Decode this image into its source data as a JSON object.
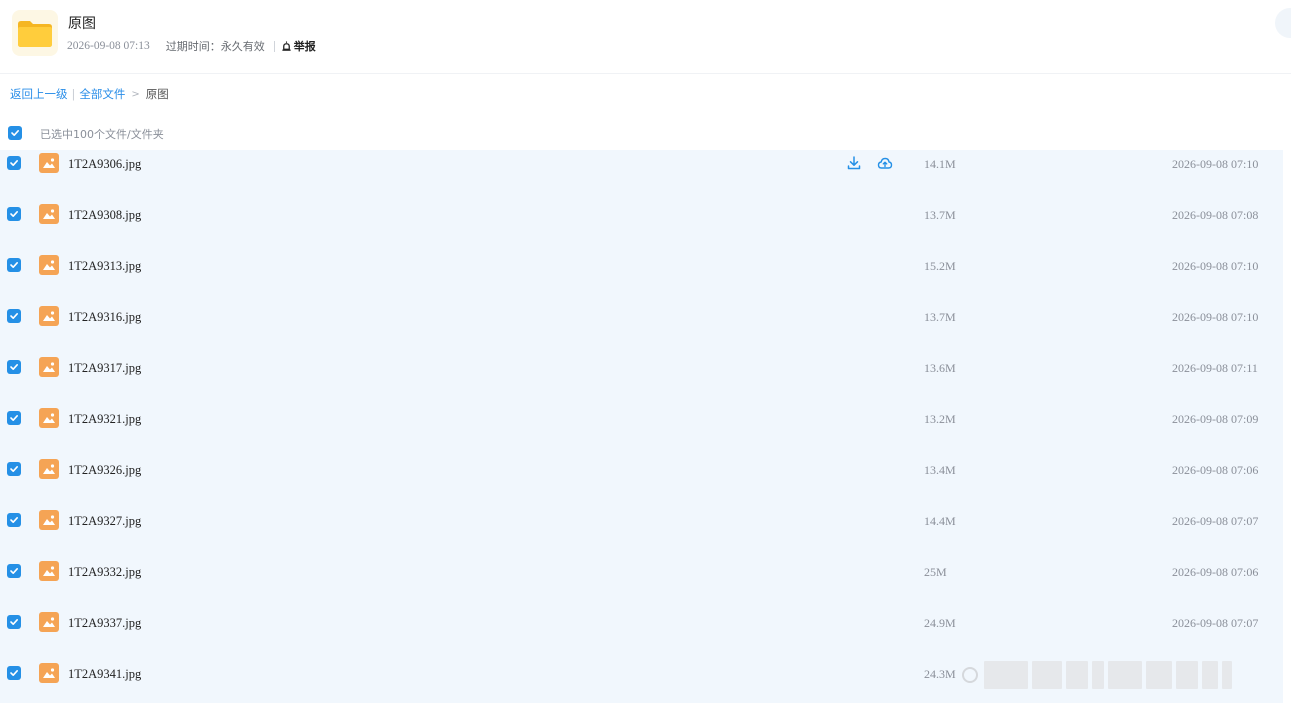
{
  "header": {
    "title": "原图",
    "created": "2026-09-08 07:13",
    "expiry_label": "过期时间：",
    "expiry_value": "永久有效",
    "report_label": "举报"
  },
  "breadcrumb": {
    "back": "返回上一级",
    "all_files": "全部文件",
    "separator": ">",
    "current": "原图"
  },
  "selection": {
    "text": "已选中100个文件/文件夹",
    "checked": true
  },
  "colors": {
    "accent": "#2590e6",
    "link": "#2a8ee8",
    "list_bg": "#f1f7fd",
    "image_icon": "#f5a455",
    "folder": "#ffc52e"
  },
  "icons": {
    "folder": "folder-icon",
    "file": "image-file-icon",
    "download": "download-icon",
    "save": "cloud-save-icon",
    "report": "alarm-bell-icon",
    "check": "check-icon"
  },
  "files": [
    {
      "name": "1T2A9306.jpg",
      "size": "14.1M",
      "date": "2026-09-08 07:10",
      "hover": true
    },
    {
      "name": "1T2A9308.jpg",
      "size": "13.7M",
      "date": "2026-09-08 07:08"
    },
    {
      "name": "1T2A9313.jpg",
      "size": "15.2M",
      "date": "2026-09-08 07:10"
    },
    {
      "name": "1T2A9316.jpg",
      "size": "13.7M",
      "date": "2026-09-08 07:10"
    },
    {
      "name": "1T2A9317.jpg",
      "size": "13.6M",
      "date": "2026-09-08 07:11"
    },
    {
      "name": "1T2A9321.jpg",
      "size": "13.2M",
      "date": "2026-09-08 07:09"
    },
    {
      "name": "1T2A9326.jpg",
      "size": "13.4M",
      "date": "2026-09-08 07:06"
    },
    {
      "name": "1T2A9327.jpg",
      "size": "14.4M",
      "date": "2026-09-08 07:07"
    },
    {
      "name": "1T2A9332.jpg",
      "size": "25M",
      "date": "2026-09-08 07:06"
    },
    {
      "name": "1T2A9337.jpg",
      "size": "24.9M",
      "date": "2026-09-08 07:07"
    },
    {
      "name": "1T2A9341.jpg",
      "size": "24.3M",
      "date": ""
    }
  ]
}
